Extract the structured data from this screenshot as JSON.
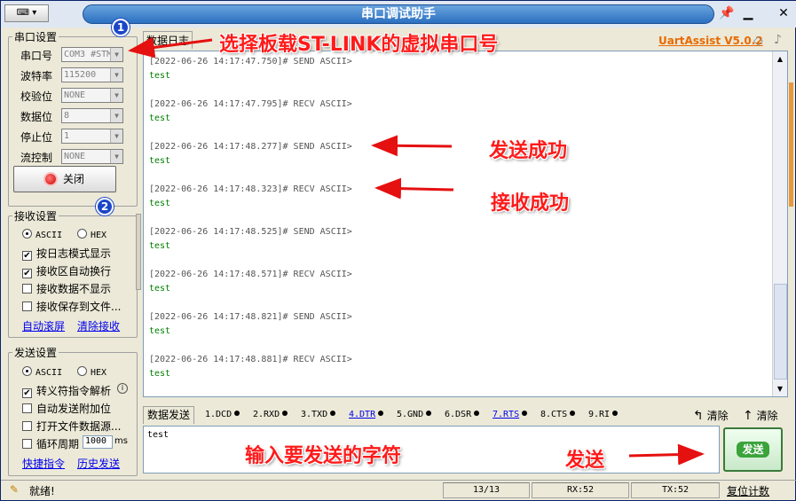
{
  "window": {
    "title": "串口调试助手",
    "sysmenu_label": "⌨ ▾",
    "pin_icon": "pin-icon",
    "min_icon": "minimize-icon",
    "close_icon": "close-icon"
  },
  "serial_settings": {
    "legend": "串口设置",
    "fields": [
      {
        "label": "串口号",
        "value": "COM3 #STM"
      },
      {
        "label": "波特率",
        "value": "115200"
      },
      {
        "label": "校验位",
        "value": "NONE"
      },
      {
        "label": "数据位",
        "value": "8"
      },
      {
        "label": "停止位",
        "value": "1"
      },
      {
        "label": "流控制",
        "value": "NONE"
      }
    ],
    "close_button": "关闭"
  },
  "receive_settings": {
    "legend": "接收设置",
    "ascii": "ASCII",
    "hex": "HEX",
    "options": [
      {
        "label": "按日志模式显示",
        "checked": true
      },
      {
        "label": "接收区自动换行",
        "checked": true
      },
      {
        "label": "接收数据不显示",
        "checked": false
      },
      {
        "label": "接收保存到文件...",
        "checked": false
      }
    ],
    "link_autoscroll": "自动滚屏",
    "link_clear": "清除接收"
  },
  "send_settings": {
    "legend": "发送设置",
    "ascii": "ASCII",
    "hex": "HEX",
    "options": [
      {
        "label": "转义符指令解析",
        "checked": true
      },
      {
        "label": "自动发送附加位",
        "checked": false
      },
      {
        "label": "打开文件数据源...",
        "checked": false
      },
      {
        "label": "循环周期",
        "checked": false
      }
    ],
    "period_value": "1000",
    "period_unit": "ms",
    "link_shortcut": "快捷指令",
    "link_history": "历史发送"
  },
  "log": {
    "tab": "数据日志",
    "brand": "UartAssist V5.0.2",
    "entries": [
      {
        "header": "[2022-06-26 14:17:47.750]# SEND ASCII>",
        "data": "test"
      },
      {
        "header": "[2022-06-26 14:17:47.795]# RECV ASCII>",
        "data": "test"
      },
      {
        "header": "[2022-06-26 14:17:48.277]# SEND ASCII>",
        "data": "test"
      },
      {
        "header": "[2022-06-26 14:17:48.323]# RECV ASCII>",
        "data": "test"
      },
      {
        "header": "[2022-06-26 14:17:48.525]# SEND ASCII>",
        "data": "test"
      },
      {
        "header": "[2022-06-26 14:17:48.571]# RECV ASCII>",
        "data": "test"
      },
      {
        "header": "[2022-06-26 14:17:48.821]# SEND ASCII>",
        "data": "test"
      },
      {
        "header": "[2022-06-26 14:17:48.881]# RECV ASCII>",
        "data": "test"
      }
    ]
  },
  "send_bar": {
    "tab": "数据发送",
    "signals": [
      "1.DCD",
      "2.RXD",
      "3.TXD",
      "4.DTR",
      "5.GND",
      "6.DSR",
      "7.RTS",
      "8.CTS",
      "9.RI"
    ],
    "clear1": "清除",
    "clear2": "清除"
  },
  "send_area": {
    "value": "test"
  },
  "send_button": "发送",
  "status": {
    "ready": "就绪!",
    "count": "13/13",
    "rx": "RX:52",
    "tx": "TX:52",
    "reset": "复位计数"
  },
  "annotations": {
    "a1": "选择板载ST-LINK的虚拟串口号",
    "a2": "发送成功",
    "a3": "接收成功",
    "a4": "输入要发送的字符",
    "a5": "发送",
    "badge1": "1",
    "badge2": "2"
  },
  "colors": {
    "accent": "#2b6fc0",
    "annotation": "#ff1a1a",
    "recv_data": "#008000",
    "brand": "#e86a00"
  }
}
